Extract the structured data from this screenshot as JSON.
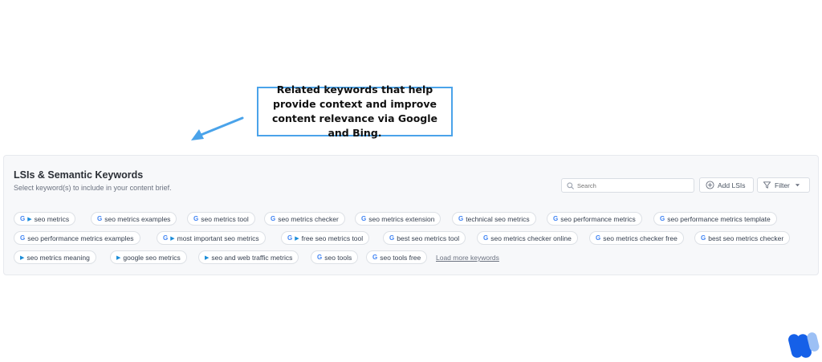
{
  "callout": {
    "text": "Related keywords that help provide context and improve content relevance via Google and Bing."
  },
  "panel": {
    "title": "LSIs & Semantic Keywords",
    "subtitle": "Select keyword(s) to include in your content brief."
  },
  "toolbar": {
    "search_placeholder": "Search",
    "add_label": "Add LSIs",
    "filter_label": "Filter"
  },
  "keywords": [
    [
      {
        "label": "seo metrics",
        "sources": [
          "google",
          "bing"
        ]
      },
      {
        "label": "seo metrics examples",
        "sources": [
          "google"
        ]
      },
      {
        "label": "seo metrics tool",
        "sources": [
          "google"
        ]
      },
      {
        "label": "seo metrics checker",
        "sources": [
          "google"
        ]
      },
      {
        "label": "seo metrics extension",
        "sources": [
          "google"
        ]
      },
      {
        "label": "technical seo metrics",
        "sources": [
          "google"
        ]
      },
      {
        "label": "seo performance metrics",
        "sources": [
          "google"
        ]
      },
      {
        "label": "seo performance metrics template",
        "sources": [
          "google"
        ]
      }
    ],
    [
      {
        "label": "seo performance metrics examples",
        "sources": [
          "google"
        ]
      },
      {
        "label": "most important seo metrics",
        "sources": [
          "google",
          "bing"
        ]
      },
      {
        "label": "free seo metrics tool",
        "sources": [
          "google",
          "bing"
        ]
      },
      {
        "label": "best seo metrics tool",
        "sources": [
          "google"
        ]
      },
      {
        "label": "seo metrics checker online",
        "sources": [
          "google"
        ]
      },
      {
        "label": "seo metrics checker free",
        "sources": [
          "google"
        ]
      },
      {
        "label": "best seo metrics checker",
        "sources": [
          "google"
        ]
      }
    ],
    [
      {
        "label": "seo metrics meaning",
        "sources": [
          "bing"
        ]
      },
      {
        "label": "google seo metrics",
        "sources": [
          "bing"
        ]
      },
      {
        "label": "seo and web traffic metrics",
        "sources": [
          "bing"
        ]
      },
      {
        "label": "seo tools",
        "sources": [
          "google"
        ]
      },
      {
        "label": "seo tools free",
        "sources": [
          "google"
        ]
      }
    ]
  ],
  "load_more_label": "Load more keywords",
  "icons": {
    "google": "G",
    "bing": "▶"
  },
  "colors": {
    "accent": "#4aa3ea",
    "google": "#4285f4",
    "bing": "#1a8cd8",
    "logo": "#1560e8"
  }
}
